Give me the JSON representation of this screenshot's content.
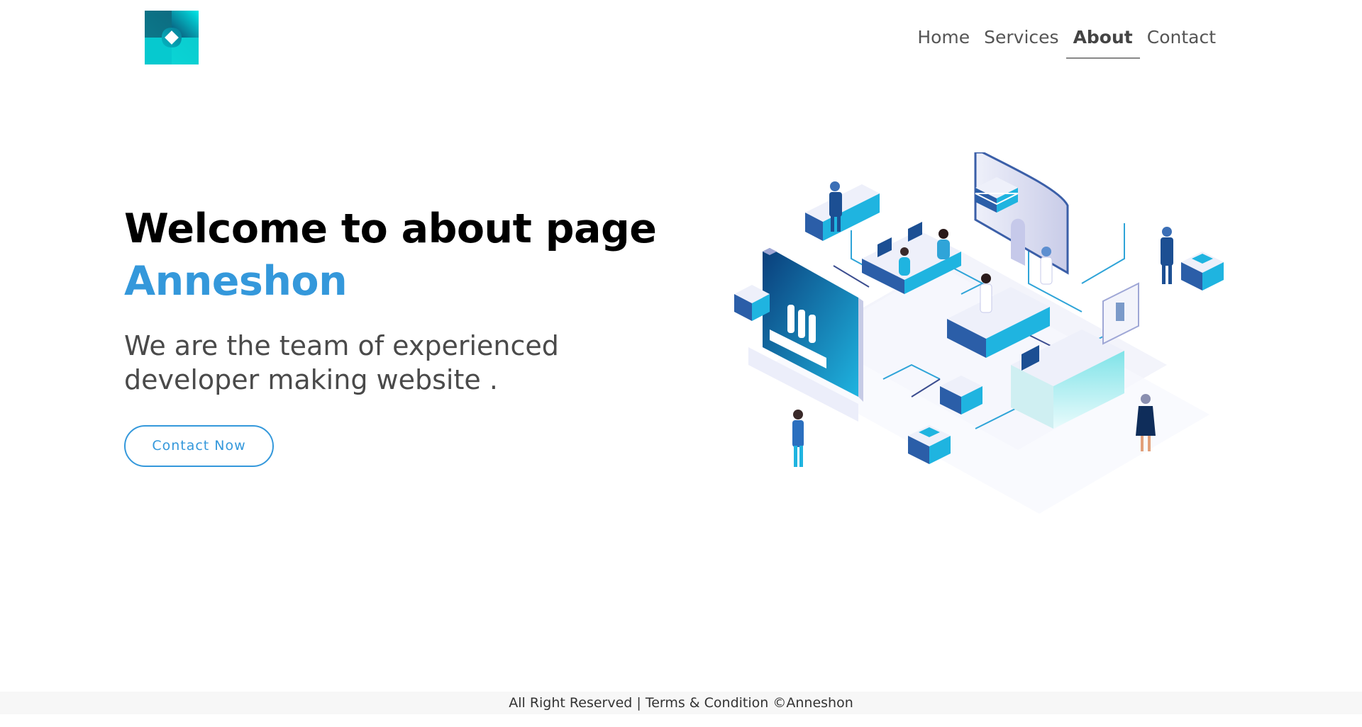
{
  "nav": {
    "logo_label": "",
    "items": [
      {
        "label": "Home",
        "active": false
      },
      {
        "label": "Services",
        "active": false
      },
      {
        "label": "About",
        "active": true
      },
      {
        "label": "Contact",
        "active": false
      }
    ]
  },
  "hero": {
    "title": "Welcome to about page",
    "brand": "Anneshon",
    "subtitle": "We are the team of experienced developer making website .",
    "cta_label": "Contact Now"
  },
  "footer": {
    "text": "All Right Reserved | Terms & Condition ©Anneshon"
  },
  "colors": {
    "accent": "#3498db",
    "logo_gradient_start": "#00e5e5",
    "logo_gradient_end": "#0a4a6e",
    "footer_bg": "#f7f7f7"
  }
}
